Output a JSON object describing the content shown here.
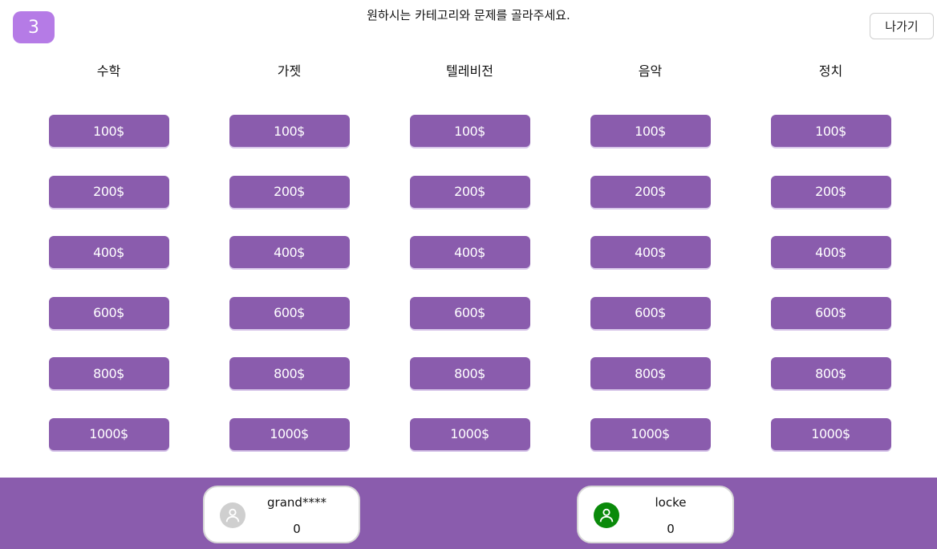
{
  "header": {
    "round_number": "3",
    "instruction": "원하시는 카테고리와 문제를 골라주세요.",
    "exit_label": "나가기"
  },
  "board": {
    "categories": [
      {
        "title": "수학",
        "values": [
          "100$",
          "200$",
          "400$",
          "600$",
          "800$",
          "1000$"
        ]
      },
      {
        "title": "가젯",
        "values": [
          "100$",
          "200$",
          "400$",
          "600$",
          "800$",
          "1000$"
        ]
      },
      {
        "title": "텔레비전",
        "values": [
          "100$",
          "200$",
          "400$",
          "600$",
          "800$",
          "1000$"
        ]
      },
      {
        "title": "음악",
        "values": [
          "100$",
          "200$",
          "400$",
          "600$",
          "800$",
          "1000$"
        ]
      },
      {
        "title": "정치",
        "values": [
          "100$",
          "200$",
          "400$",
          "600$",
          "800$",
          "1000$"
        ]
      }
    ]
  },
  "players": [
    {
      "name": "grand****",
      "score": "0",
      "avatar_icon": "user-icon",
      "avatar_color": "#cfcfcf"
    },
    {
      "name": "locke",
      "score": "0",
      "avatar_icon": "user-icon",
      "avatar_color": "#0a8a0a"
    }
  ],
  "colors": {
    "accent": "#8a5cad",
    "round_badge": "#b57be6"
  }
}
